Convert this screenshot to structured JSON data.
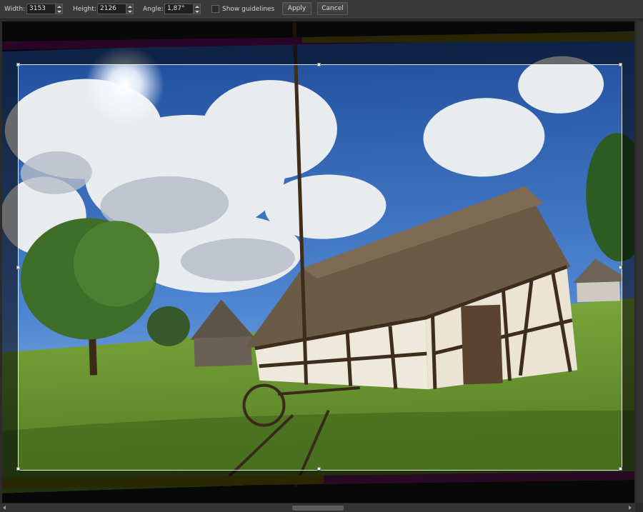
{
  "toolbar": {
    "width_label": "Width:",
    "width_value": "3153",
    "height_label": "Height:",
    "height_value": "2126",
    "angle_label": "Angle:",
    "angle_value": "1,87°",
    "show_guidelines_label": "Show guidelines",
    "show_guidelines_checked": false,
    "apply_label": "Apply",
    "cancel_label": "Cancel"
  },
  "canvas": {
    "image": "farm-landscape-photo",
    "background_color": "#121212"
  },
  "scrollbars": {
    "horizontal": "horizontal-scrollbar",
    "vertical": "vertical-scrollbar"
  }
}
